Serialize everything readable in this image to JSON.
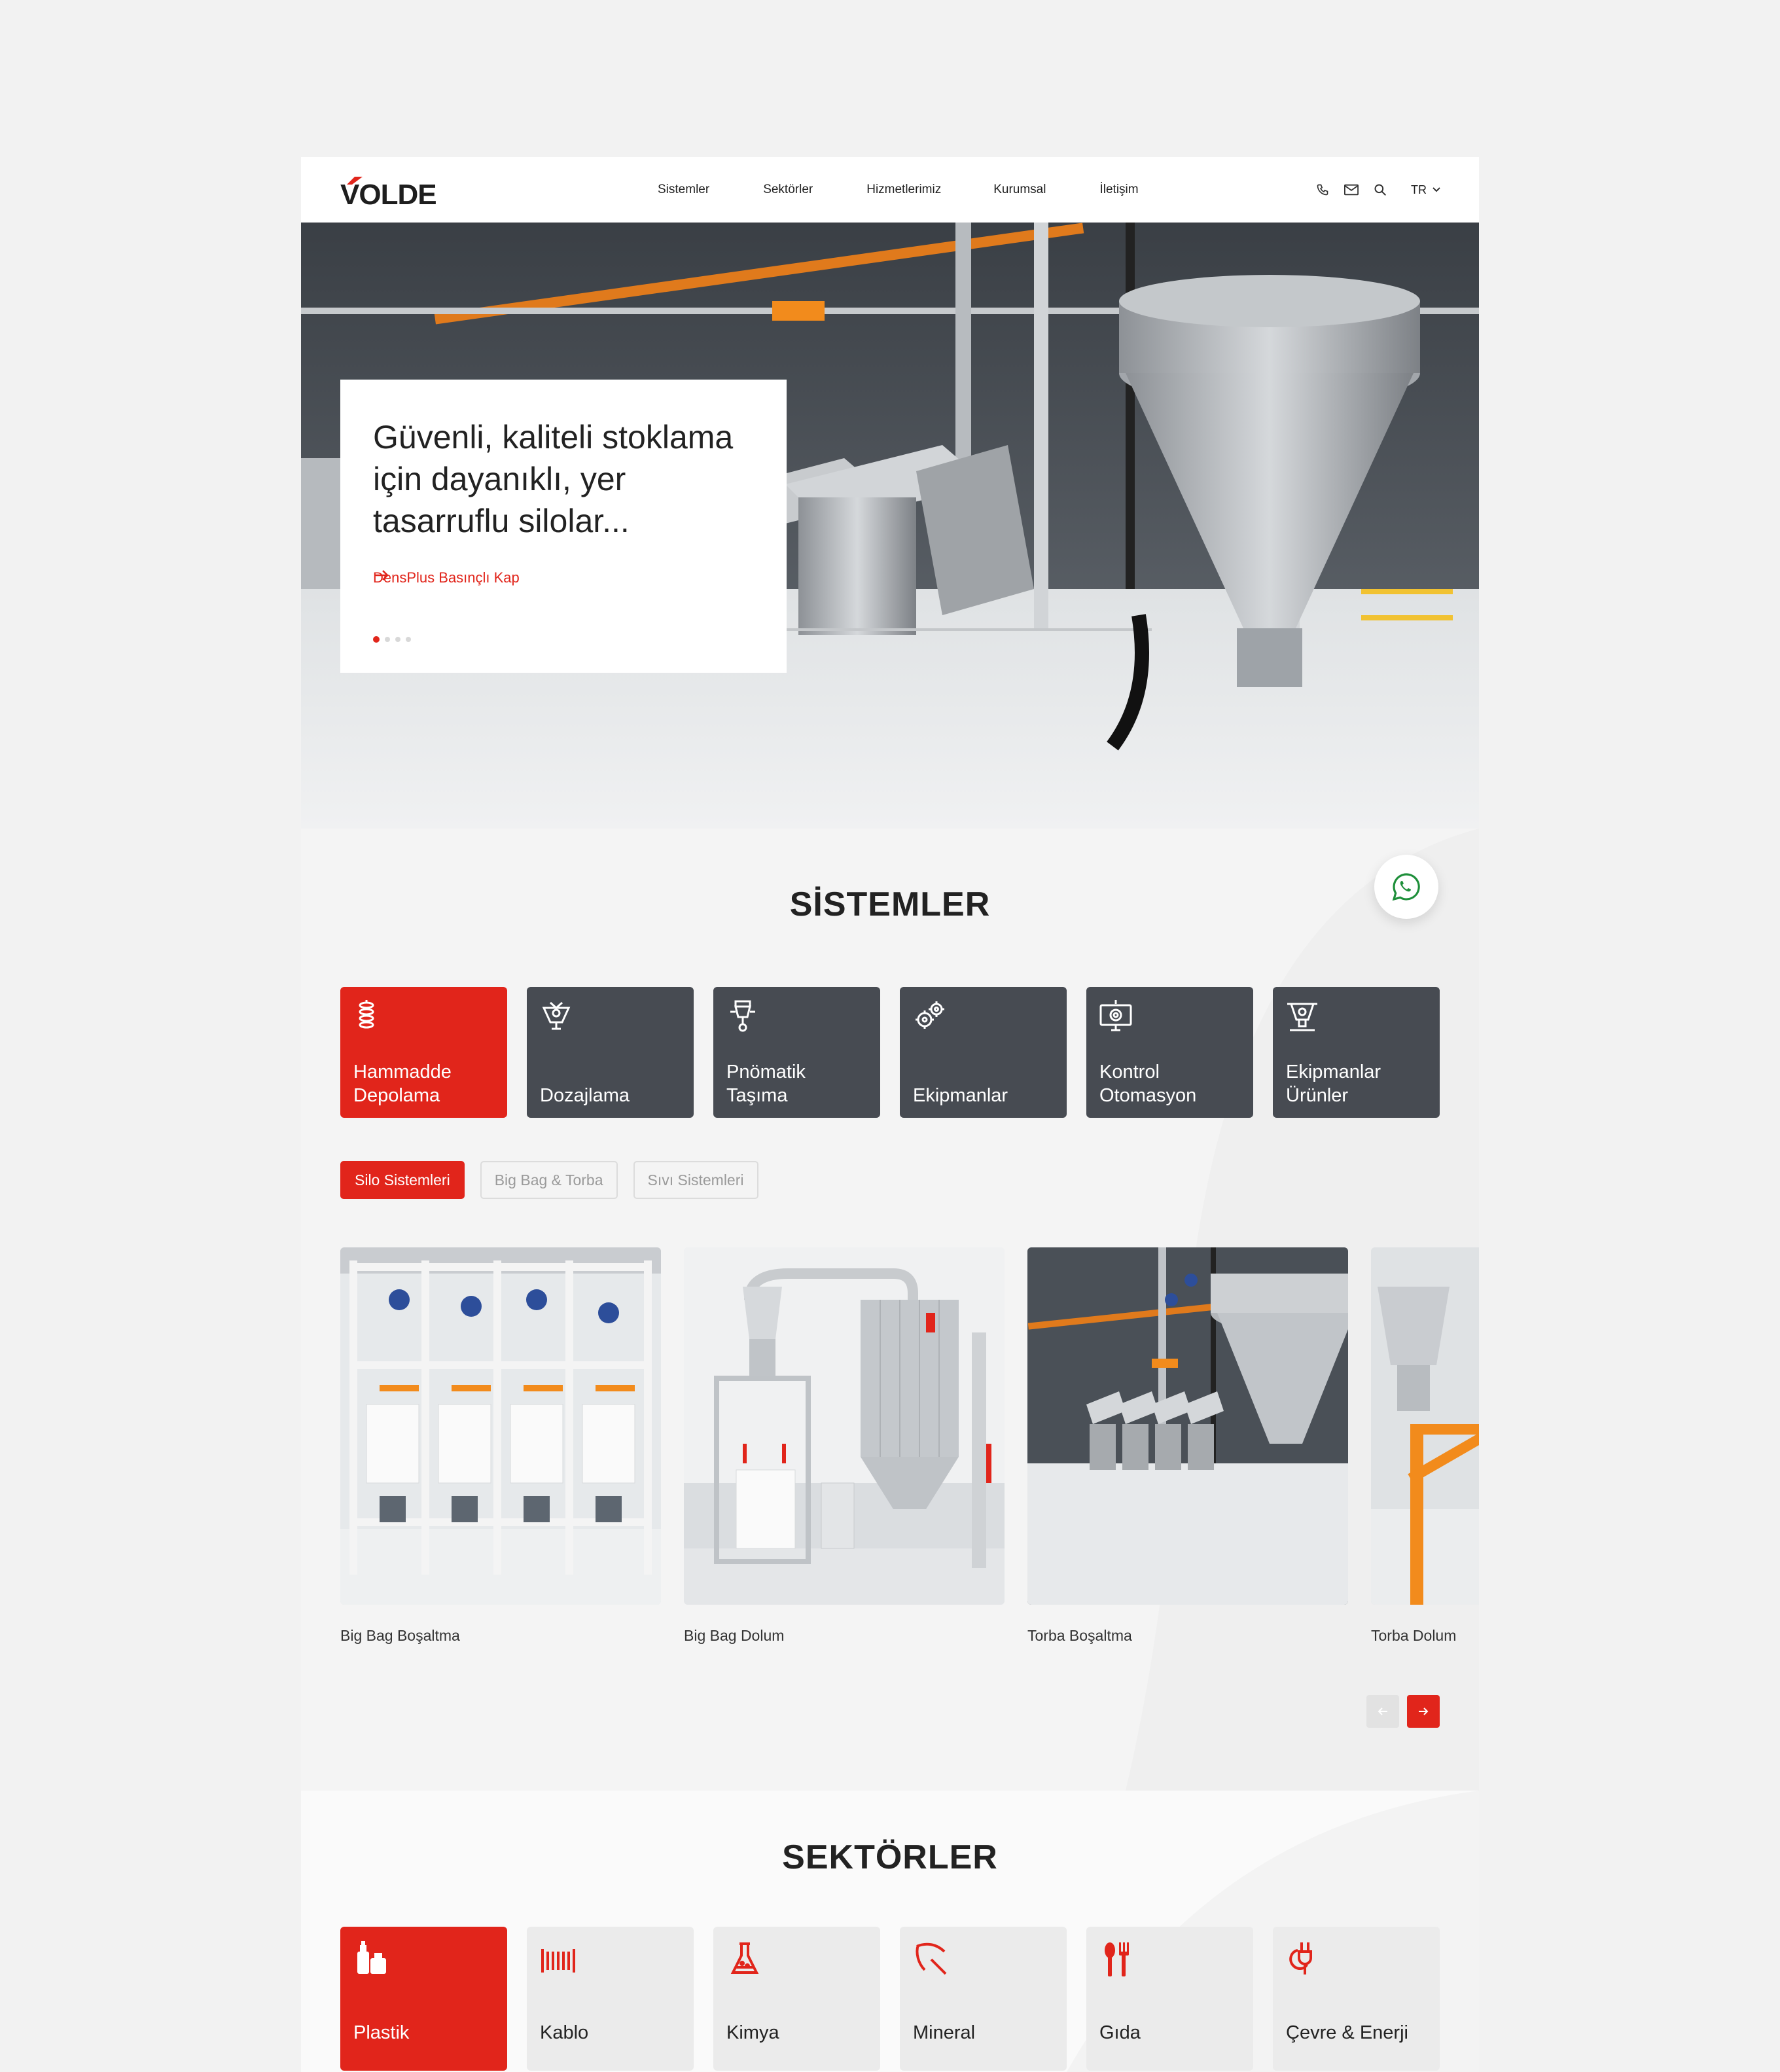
{
  "brand": {
    "name": "VOLDE",
    "accent": "#e1251b",
    "dark_tile": "#474b52"
  },
  "nav": {
    "items": [
      "Sistemler",
      "Sektörler",
      "Hizmetlerimiz",
      "Kurumsal",
      "İletişim"
    ],
    "icons": [
      "phone-icon",
      "mail-icon",
      "search-icon"
    ],
    "language": "TR"
  },
  "hero": {
    "title": "Güvenli, kaliteli stoklama için dayanıklı, yer tasarruflu silolar...",
    "link_label": "DensPlus Basınçlı Kap",
    "slides_total": 4,
    "active_slide": 1
  },
  "systems": {
    "title": "SİSTEMLER",
    "tiles": [
      {
        "line1": "Hammadde",
        "line2": "Depolama",
        "icon": "silo-stack-icon",
        "active": true
      },
      {
        "line1": "",
        "line2": "Dozajlama",
        "icon": "dosing-icon",
        "active": false
      },
      {
        "line1": "Pnömatik",
        "line2": "Taşıma",
        "icon": "pneumatic-icon",
        "active": false
      },
      {
        "line1": "",
        "line2": "Ekipmanlar",
        "icon": "gears-icon",
        "active": false
      },
      {
        "line1": "Kontrol",
        "line2": "Otomasyon",
        "icon": "control-monitor-icon",
        "active": false
      },
      {
        "line1": "Ekipmanlar",
        "line2": "Ürünler",
        "icon": "hopper-icon",
        "active": false
      }
    ],
    "filters": [
      {
        "label": "Silo Sistemleri",
        "active": true
      },
      {
        "label": "Big Bag & Torba",
        "active": false
      },
      {
        "label": "Sıvı Sistemleri",
        "active": false
      }
    ],
    "cards": [
      {
        "caption": "Big Bag Boşaltma"
      },
      {
        "caption": "Big Bag Dolum"
      },
      {
        "caption": "Torba Boşaltma"
      },
      {
        "caption": "Torba Dolum"
      }
    ]
  },
  "sectors": {
    "title": "SEKTÖRLER",
    "tiles": [
      {
        "label": "Plastik",
        "icon": "plastic-bottles-icon",
        "active": true
      },
      {
        "label": "Kablo",
        "icon": "cable-icon",
        "active": false
      },
      {
        "label": "Kimya",
        "icon": "flask-icon",
        "active": false
      },
      {
        "label": "Mineral",
        "icon": "pickaxe-icon",
        "active": false
      },
      {
        "label": "Gıda",
        "icon": "cutlery-icon",
        "active": false
      },
      {
        "label": "Çevre & Enerji",
        "icon": "eco-plug-icon",
        "active": false
      }
    ]
  },
  "whatsapp": {
    "icon": "whatsapp-icon"
  }
}
